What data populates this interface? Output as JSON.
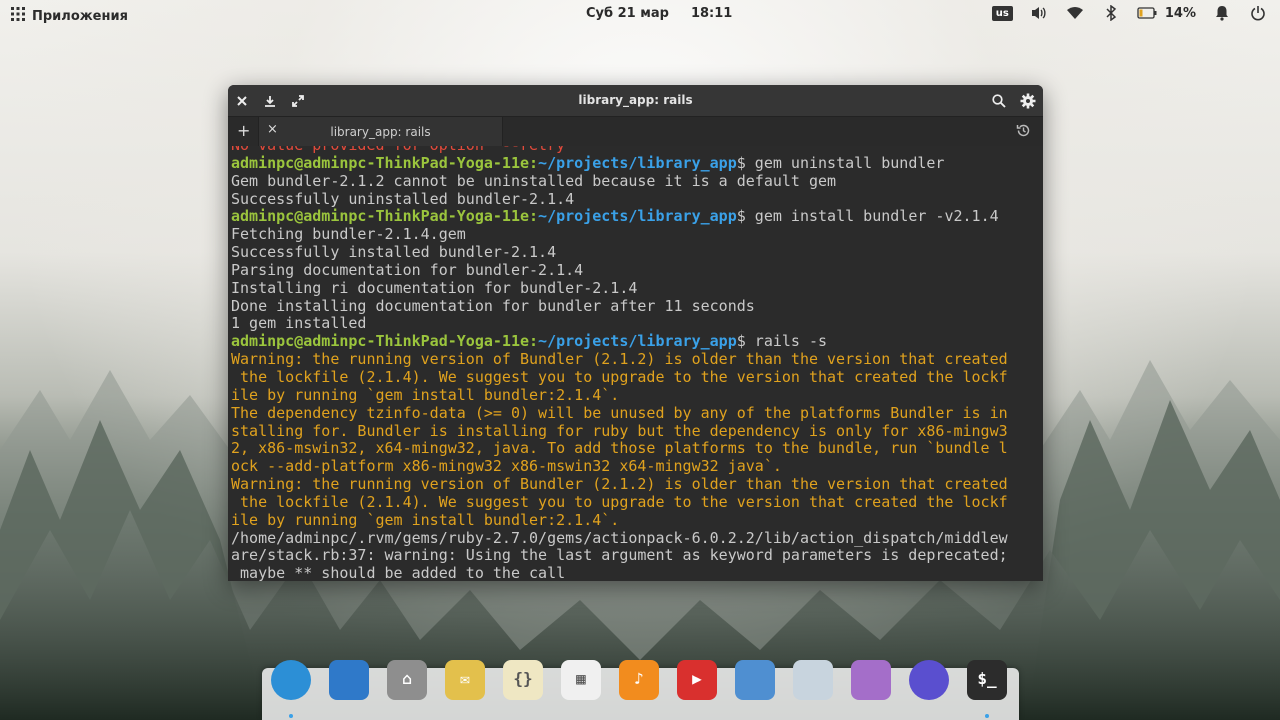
{
  "panel": {
    "apps_label": "Приложения",
    "date": "Суб 21 мар",
    "time": "18:11",
    "keyboard_layout": "us",
    "battery": "14%"
  },
  "window": {
    "title": "library_app: rails",
    "tab_label": "library_app: rails"
  },
  "terminal": {
    "lines": [
      {
        "type": "err",
        "text": "No value provided for option '--retry'"
      },
      {
        "type": "prompt",
        "user": "adminpc@adminpc-ThinkPad-Yoga-11e",
        "path": "~/projects/library_app",
        "cmd": "$ gem uninstall bundler"
      },
      {
        "type": "out",
        "text": "Gem bundler-2.1.2 cannot be uninstalled because it is a default gem"
      },
      {
        "type": "out",
        "text": "Successfully uninstalled bundler-2.1.4"
      },
      {
        "type": "prompt",
        "user": "adminpc@adminpc-ThinkPad-Yoga-11e",
        "path": "~/projects/library_app",
        "cmd": "$ gem install bundler -v2.1.4"
      },
      {
        "type": "out",
        "text": "Fetching bundler-2.1.4.gem"
      },
      {
        "type": "out",
        "text": "Successfully installed bundler-2.1.4"
      },
      {
        "type": "out",
        "text": "Parsing documentation for bundler-2.1.4"
      },
      {
        "type": "out",
        "text": "Installing ri documentation for bundler-2.1.4"
      },
      {
        "type": "out",
        "text": "Done installing documentation for bundler after 11 seconds"
      },
      {
        "type": "out",
        "text": "1 gem installed"
      },
      {
        "type": "prompt",
        "user": "adminpc@adminpc-ThinkPad-Yoga-11e",
        "path": "~/projects/library_app",
        "cmd": "$ rails -s"
      },
      {
        "type": "warn",
        "text": "Warning: the running version of Bundler (2.1.2) is older than the version that created"
      },
      {
        "type": "warn",
        "text": " the lockfile (2.1.4). We suggest you to upgrade to the version that created the lockf"
      },
      {
        "type": "warn",
        "text": "ile by running `gem install bundler:2.1.4`."
      },
      {
        "type": "warn",
        "text": "The dependency tzinfo-data (>= 0) will be unused by any of the platforms Bundler is in"
      },
      {
        "type": "warn",
        "text": "stalling for. Bundler is installing for ruby but the dependency is only for x86-mingw3"
      },
      {
        "type": "warn",
        "text": "2, x86-mswin32, x64-mingw32, java. To add those platforms to the bundle, run `bundle l"
      },
      {
        "type": "warn",
        "text": "ock --add-platform x86-mingw32 x86-mswin32 x64-mingw32 java`."
      },
      {
        "type": "warn",
        "text": "Warning: the running version of Bundler (2.1.2) is older than the version that created"
      },
      {
        "type": "warn",
        "text": " the lockfile (2.1.4). We suggest you to upgrade to the version that created the lockf"
      },
      {
        "type": "warn",
        "text": "ile by running `gem install bundler:2.1.4`."
      },
      {
        "type": "out",
        "text": "/home/adminpc/.rvm/gems/ruby-2.7.0/gems/actionpack-6.0.2.2/lib/action_dispatch/middlew"
      },
      {
        "type": "out",
        "text": "are/stack.rb:37: warning: Using the last argument as keyword parameters is deprecated;"
      },
      {
        "type": "out",
        "text": " maybe ** should be added to the call"
      }
    ]
  },
  "dock": {
    "items": [
      {
        "name": "web-browser-icon",
        "color": "#2c8fd6"
      },
      {
        "name": "multitasking-view-icon",
        "color": "#2f79c9"
      },
      {
        "name": "files-icon",
        "color": "#8e8e8e"
      },
      {
        "name": "mail-icon",
        "color": "#e3c04c"
      },
      {
        "name": "code-editor-icon",
        "color": "#efe7c3"
      },
      {
        "name": "calendar-icon",
        "color": "#f0f0f0"
      },
      {
        "name": "music-icon",
        "color": "#f28c1e"
      },
      {
        "name": "videos-icon",
        "color": "#d9302e"
      },
      {
        "name": "photos-icon",
        "color": "#4f8fd1"
      },
      {
        "name": "system-settings-icon",
        "color": "#c8d4de"
      },
      {
        "name": "appcenter-icon",
        "color": "#a46ec9"
      },
      {
        "name": "epiphany-browser-icon",
        "color": "#5a4fcf"
      },
      {
        "name": "terminal-icon",
        "color": "#2c2c2c"
      }
    ]
  }
}
